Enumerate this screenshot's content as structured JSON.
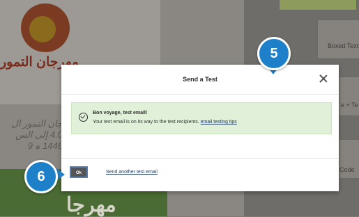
{
  "background": {
    "arabic_title": "مهرجان التمور",
    "arabic_lines": [
      "جان التمور ال",
      "4.0 إلى الس",
      "1446 ه 9"
    ],
    "green_text": "مهرجا",
    "right_cards": [
      {
        "label": "Boxed Text"
      },
      {
        "label": "e + Te"
      },
      {
        "label": "Code"
      }
    ]
  },
  "modal": {
    "title": "Send a Test",
    "close_icon": "close-icon",
    "success": {
      "title": "Bon voyage, test email!",
      "message_prefix": "Your test email is on its way to the test recipients. ",
      "link_text": "email testing tips"
    },
    "ok_label": "Ok",
    "send_another_label": "Send another test email"
  },
  "badges": {
    "step5": "5",
    "step6": "6",
    "color": "#1e80c8"
  }
}
